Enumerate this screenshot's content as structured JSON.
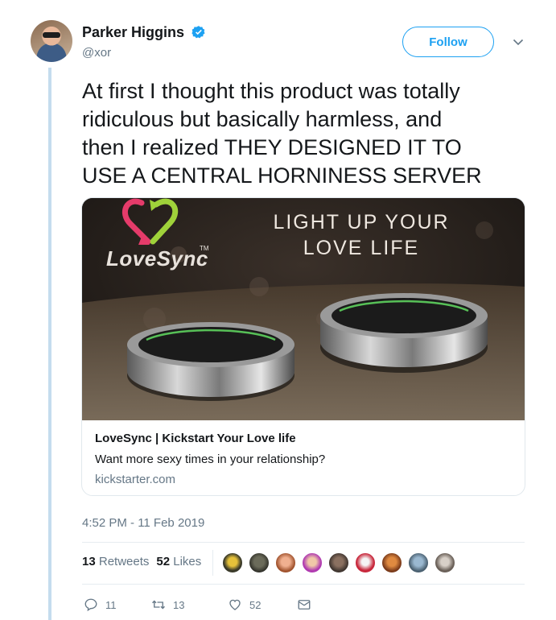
{
  "author": {
    "name": "Parker Higgins",
    "handle": "@xor",
    "verified": true
  },
  "follow_label": "Follow",
  "tweet": {
    "lines": [
      "At first I thought this product was totally",
      "ridiculous but basically harmless, and",
      "then I realized THEY DESIGNED IT TO",
      "USE A CENTRAL HORNINESS SERVER"
    ]
  },
  "card": {
    "image": {
      "logo_text": "LoveSync",
      "trademark": "TM",
      "headline_line1": "LIGHT UP YOUR",
      "headline_line2": "LOVE LIFE"
    },
    "title": "LoveSync | Kickstart Your Love life",
    "description": "Want more sexy times in your relationship?",
    "domain": "kickstarter.com"
  },
  "timestamp": "4:52 PM - 11 Feb 2019",
  "stats": {
    "retweets_count": "13",
    "retweets_label": "Retweets",
    "likes_count": "52",
    "likes_label": "Likes"
  },
  "actions": {
    "reply_count": "11",
    "retweet_count": "13",
    "like_count": "52"
  },
  "colors": {
    "accent": "#1da1f2",
    "text": "#14171a",
    "muted": "#657786",
    "thread_line": "#c4dcee"
  },
  "icons": [
    "verified-badge-icon",
    "chevron-down-icon",
    "reply-icon",
    "retweet-icon",
    "heart-icon",
    "message-icon"
  ]
}
